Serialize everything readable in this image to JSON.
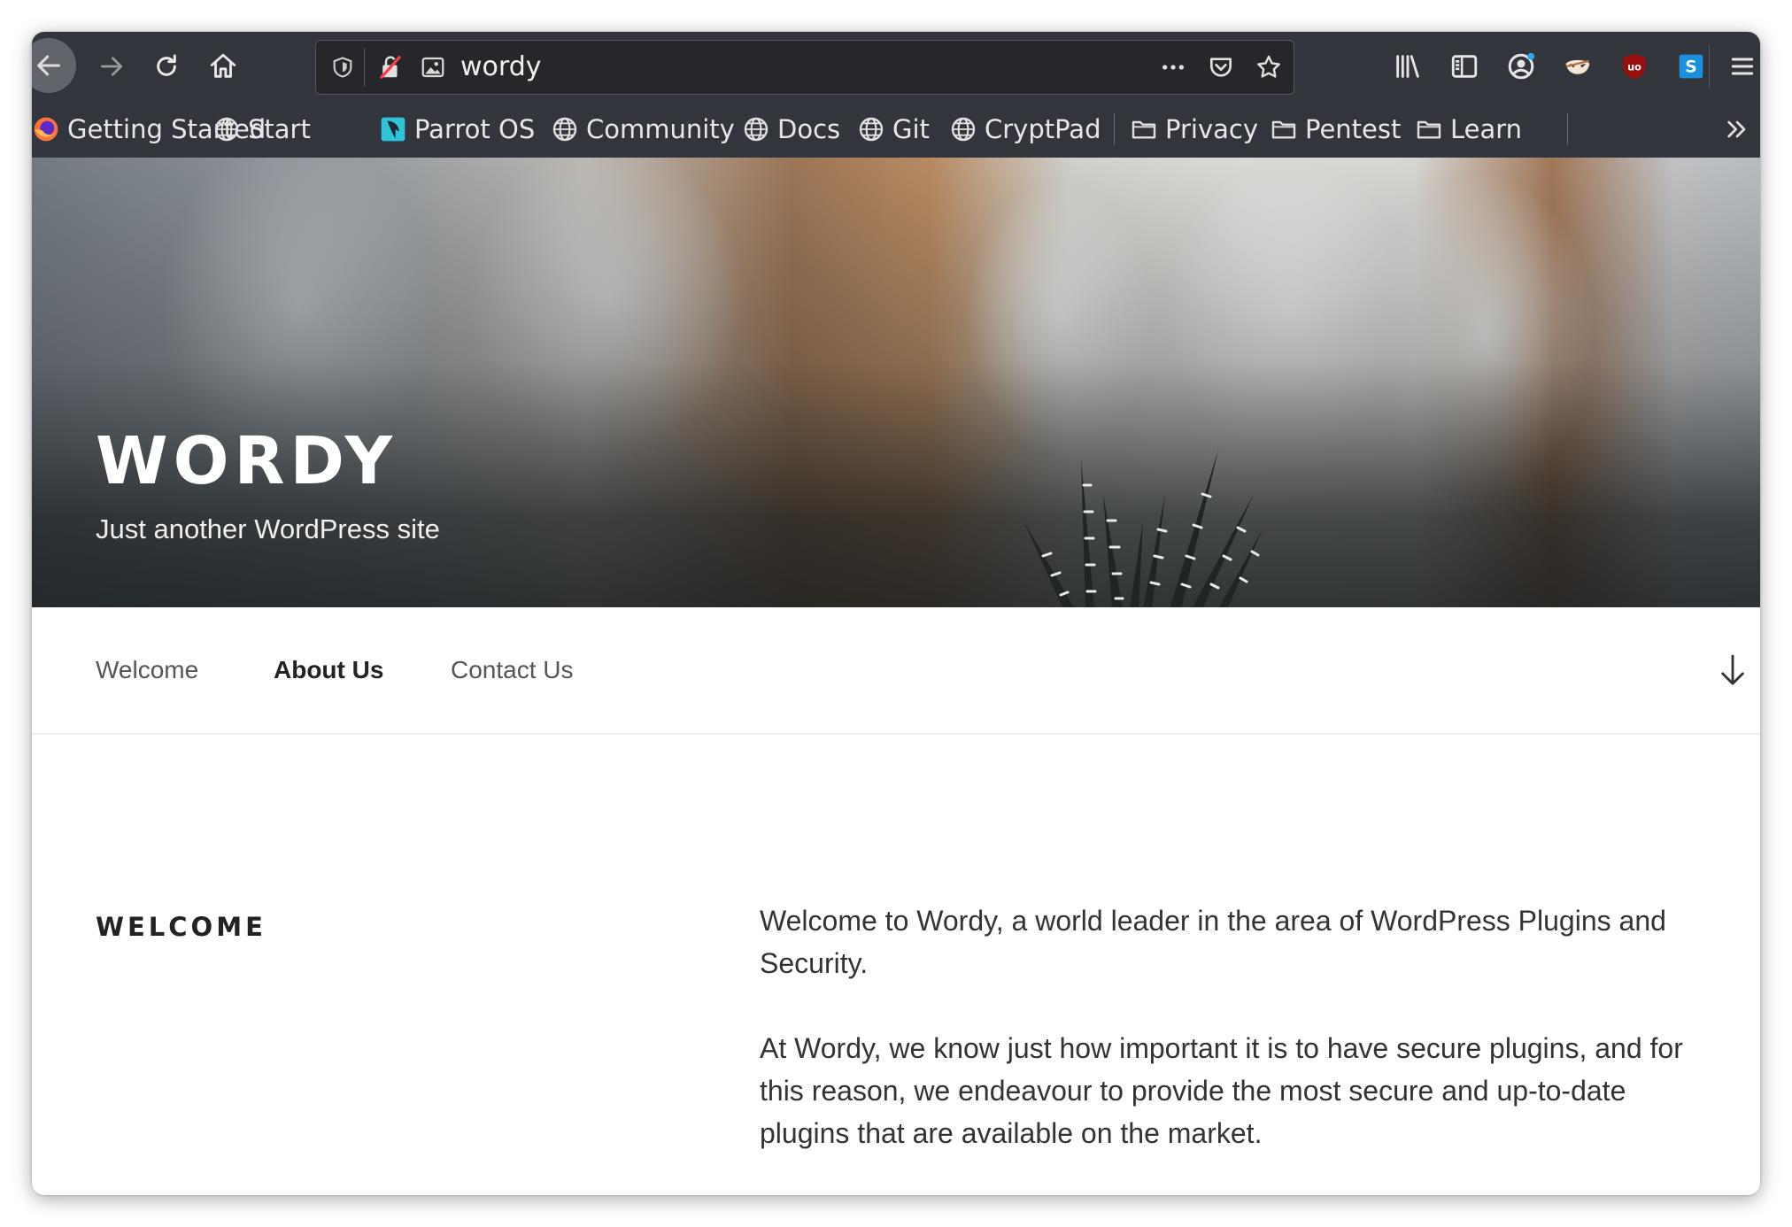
{
  "browser": {
    "url_text": "wordy",
    "icons": {
      "back": "back-arrow-icon",
      "forward": "forward-arrow-icon",
      "reload": "reload-icon",
      "home": "home-icon",
      "shield": "tracking-shield-icon",
      "insecure": "insecure-connection-icon",
      "permissions": "image-permission-icon",
      "page_actions": "more-actions-icon",
      "pocket": "pocket-icon",
      "bookmark_star": "bookmark-star-icon",
      "library": "library-icon",
      "sidebar": "sidebar-icon",
      "account": "account-icon",
      "ext_mask": "mask-extension-icon",
      "ext_ublock": "ublock-origin-icon",
      "ext_s": "s-extension-icon",
      "menu": "hamburger-menu-icon",
      "overflow": "bookmarks-overflow-icon"
    }
  },
  "bookmarks": [
    {
      "label": "Getting Started",
      "icon": "firefox-icon"
    },
    {
      "label": "Start",
      "icon": "globe-icon"
    },
    {
      "label": "Parrot OS",
      "icon": "parrot-icon"
    },
    {
      "label": "Community",
      "icon": "globe-icon"
    },
    {
      "label": "Docs",
      "icon": "globe-icon"
    },
    {
      "label": "Git",
      "icon": "globe-icon"
    },
    {
      "label": "CryptPad",
      "icon": "globe-icon"
    },
    {
      "label": "Privacy",
      "icon": "folder-icon"
    },
    {
      "label": "Pentest",
      "icon": "folder-icon"
    },
    {
      "label": "Learn",
      "icon": "folder-icon"
    }
  ],
  "site": {
    "title": "WORDY",
    "tagline": "Just another WordPress site"
  },
  "nav": {
    "items": [
      {
        "label": "Welcome",
        "active": false
      },
      {
        "label": "About Us",
        "active": true
      },
      {
        "label": "Contact Us",
        "active": false
      }
    ]
  },
  "content": {
    "heading": "WELCOME",
    "paragraphs": [
      "Welcome to Wordy, a world leader in the area of WordPress Plugins and Security.",
      "At Wordy, we know just how important it is to have secure plugins, and for this reason, we endeavour to provide the most secure and up-to-date plugins that are available on the market."
    ]
  },
  "colors": {
    "toolbar": "#33353c",
    "urlbar": "#26272b",
    "nav_active": "#222222",
    "nav_inactive": "#555555",
    "body_text": "#333333"
  }
}
